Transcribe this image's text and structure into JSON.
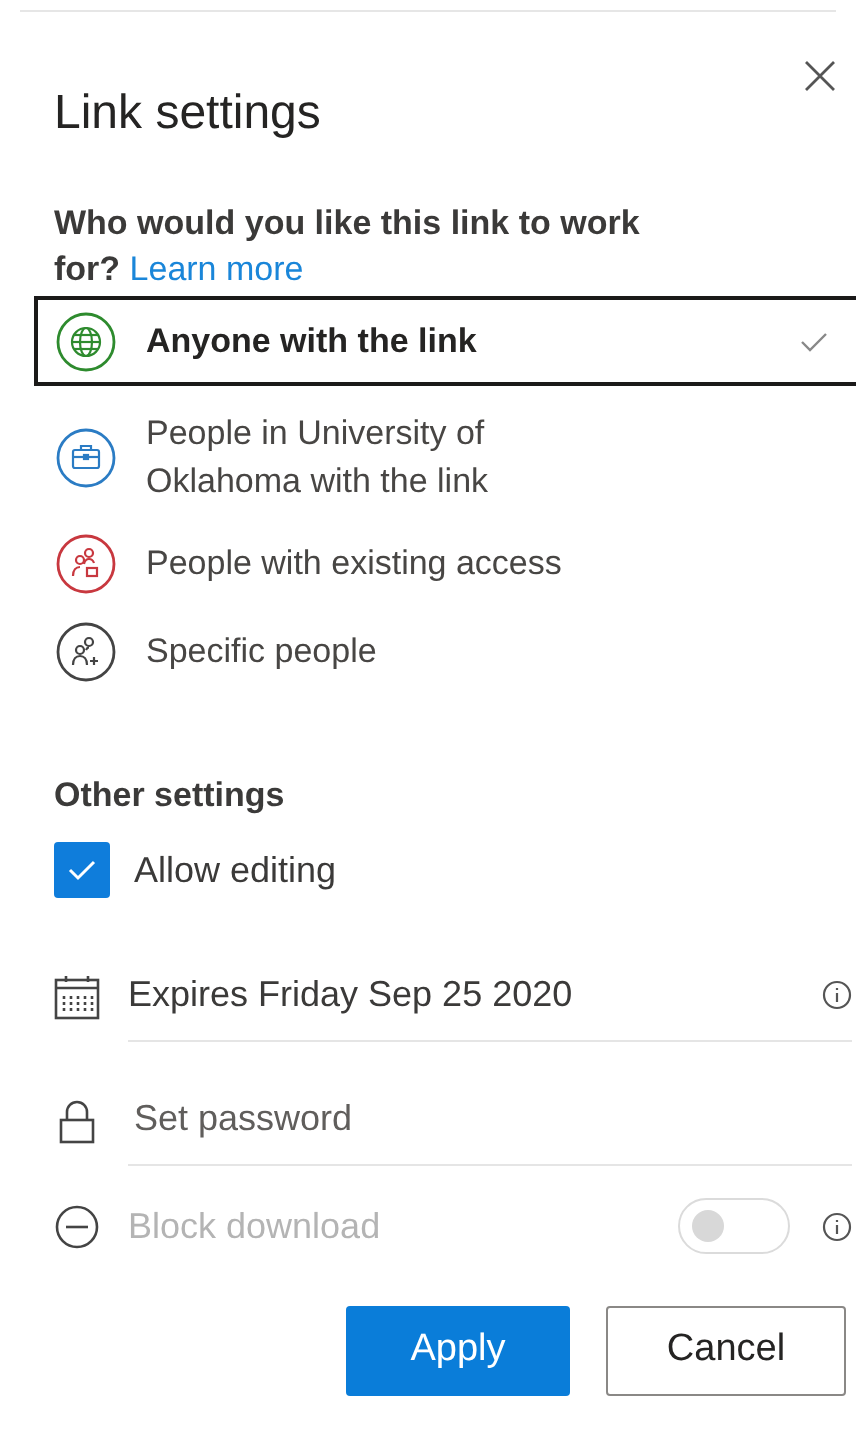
{
  "title": "Link settings",
  "question": {
    "text": "Who would you like this link to work for?",
    "link": "Learn more"
  },
  "options": [
    {
      "label": "Anyone with the link",
      "kind": "globe",
      "color": "#2e8b2e",
      "selected": true
    },
    {
      "label": "People in University of Oklahoma with the link",
      "kind": "briefcase",
      "color": "#2b7cc4",
      "selected": false
    },
    {
      "label": "People with existing access",
      "kind": "people-lock",
      "color": "#c8383f",
      "selected": false
    },
    {
      "label": "Specific people",
      "kind": "people-add",
      "color": "#444444",
      "selected": false
    }
  ],
  "other_settings": {
    "heading": "Other settings",
    "allow_editing": {
      "label": "Allow editing",
      "checked": true
    },
    "expiry": {
      "value": "Expires Friday Sep 25 2020"
    },
    "password": {
      "placeholder": "Set password"
    },
    "block_download": {
      "label": "Block download",
      "disabled": true,
      "on": false
    }
  },
  "buttons": {
    "apply": "Apply",
    "cancel": "Cancel"
  }
}
